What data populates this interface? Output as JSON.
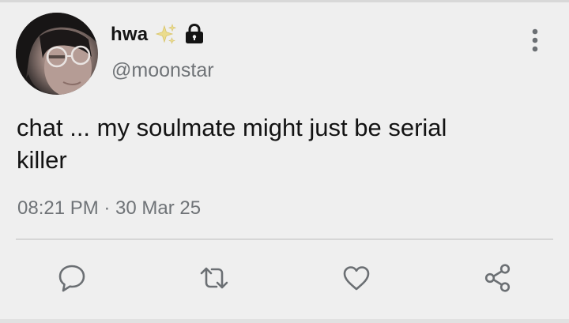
{
  "tweet": {
    "display_name": "hwa",
    "handle": "@moonstar",
    "text": "chat ... my soulmate might just be serial\nkiller",
    "timestamp": "08:21 PM · 30 Mar 25"
  },
  "icons": {
    "name_badge": "sparkles-icon",
    "protected": "lock-icon",
    "menu": "more-vertical-icon",
    "reply": "speech-bubble-icon",
    "retweet": "retweet-icon",
    "like": "heart-icon",
    "share": "share-icon"
  },
  "colors": {
    "background": "#efefef",
    "text": "#131313",
    "secondary_text": "#6f7377",
    "sparkle": "#e8d98a",
    "divider": "#d6d6d6"
  }
}
